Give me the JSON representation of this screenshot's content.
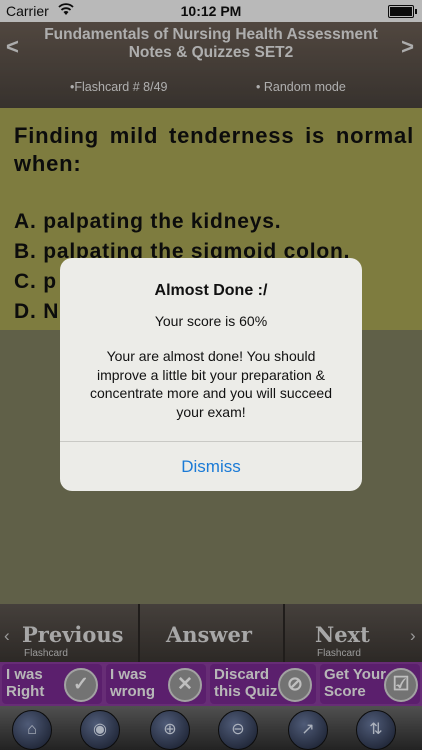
{
  "status_bar": {
    "carrier": "Carrier",
    "time": "10:12 PM"
  },
  "header": {
    "title": "Fundamentals of Nursing Health Assessment Notes & Quizzes SET2",
    "flashcard": "•Flashcard #  8/49",
    "mode": "• Random mode",
    "prev_arrow": "<",
    "next_arrow": ">"
  },
  "question": {
    "text": "Finding mild tenderness is normal when:",
    "options": [
      "A. palpating the kidneys.",
      "B. palpating the sigmoid colon.",
      "C. p",
      "D. N"
    ]
  },
  "alert": {
    "title": "Almost Done :/",
    "score": "Your score is 60%",
    "message": "Your are almost done! You should improve a little bit your preparation & concentrate more and you will succeed your exam!",
    "dismiss_label": "Dismiss"
  },
  "nav": {
    "previous_label": "Previous",
    "previous_sub": "Flashcard",
    "answer_label": "Answer",
    "next_label": "Next",
    "next_sub": "Flashcard",
    "left_chevron": "‹",
    "right_chevron": "›"
  },
  "actions": [
    {
      "label": "I was Right",
      "icon": "check-icon"
    },
    {
      "label": "I was wrong",
      "icon": "x-icon"
    },
    {
      "label": "Discard this Quiz",
      "icon": "forbidden-icon"
    },
    {
      "label": "Get Your Score",
      "icon": "clipboard-icon"
    }
  ],
  "tabs": [
    {
      "icon": "home-icon"
    },
    {
      "icon": "rss-icon"
    },
    {
      "icon": "zoom-in-icon"
    },
    {
      "icon": "zoom-out-icon"
    },
    {
      "icon": "chart-icon"
    },
    {
      "icon": "sort-az-icon"
    }
  ],
  "colors": {
    "question_bg": "#a8a655",
    "actions_bg": "#8a3d9e",
    "dismiss": "#1a7ad6"
  }
}
